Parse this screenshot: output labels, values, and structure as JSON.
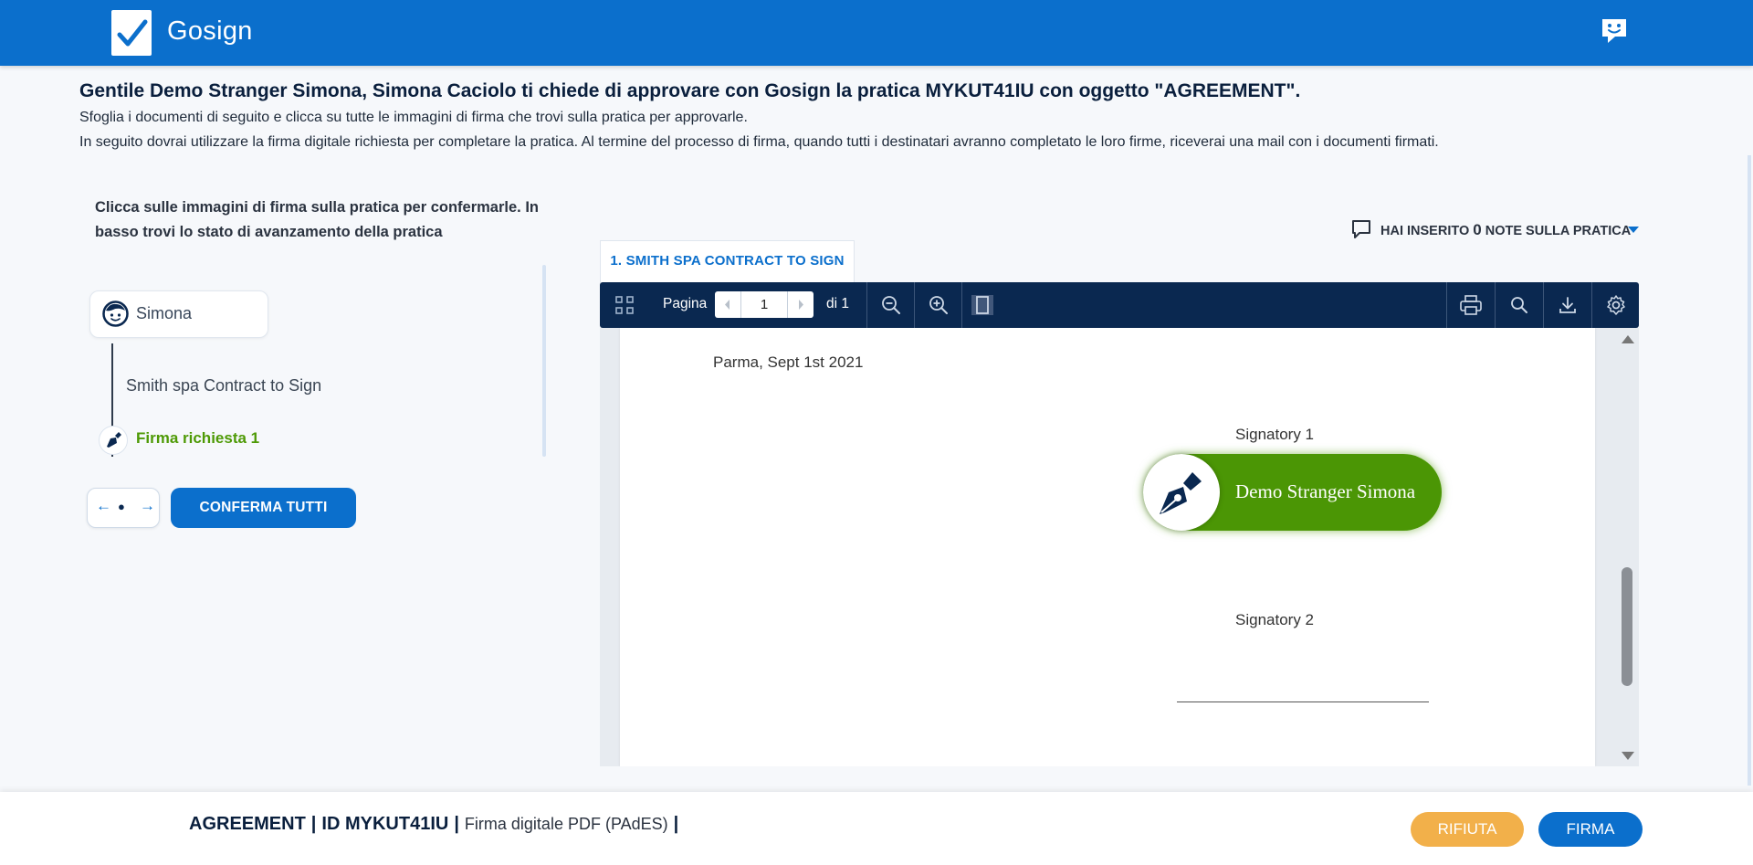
{
  "header": {
    "brand_name": "Gosign",
    "icons": {
      "logo": "check-logo-icon",
      "chat": "chat-icon"
    }
  },
  "intro": {
    "title": "Gentile Demo Stranger Simona, Simona Caciolo ti chiede di approvare con Gosign la pratica MYKUT41IU con oggetto \"AGREEMENT\".",
    "line1": "Sfoglia i documenti di seguito e clicca su tutte le immagini di firma che trovi sulla pratica per approvarle.",
    "line2": "In seguito dovrai utilizzare la firma digitale richiesta per completare la pratica. Al termine del processo di firma, quando tutti i destinatari avranno completato le loro firme, riceverai una mail con i documenti firmati."
  },
  "left_panel": {
    "instructions": "Clicca sulle immagini di firma sulla pratica per confermarle. In basso trovi lo stato di avanzamento della pratica",
    "signer_name": "Simona",
    "document_name": "Smith spa Contract to Sign",
    "signature_step": "Firma richiesta 1",
    "nav": {
      "prev": "←",
      "dot": "●",
      "next": "→"
    },
    "confirm_all": "CONFERMA TUTTI"
  },
  "notes": {
    "prefix": "HAI INSERITO",
    "count": "0",
    "suffix": "NOTE SULLA PRATICA"
  },
  "viewer": {
    "tab_label": "1. SMITH SPA CONTRACT TO SIGN",
    "toolbar": {
      "page_label": "Pagina",
      "current_page": "1",
      "of_label": "di 1"
    },
    "document": {
      "date_line": "Parma, Sept 1st 2021",
      "signatory1_label": "Signatory 1",
      "signature_name": "Demo Stranger Simona",
      "signatory2_label": "Signatory 2"
    }
  },
  "footer": {
    "subject": "AGREEMENT",
    "id_label": "ID MYKUT41IU",
    "sig_type": "Firma digitale PDF (PAdES)",
    "reject": "RIFIUTA",
    "sign": "FIRMA"
  },
  "colors": {
    "brand_blue": "#0b6fcc",
    "toolbar_navy": "#0a2850",
    "signature_green": "#4b9605",
    "reject_orange": "#f2b04a"
  }
}
